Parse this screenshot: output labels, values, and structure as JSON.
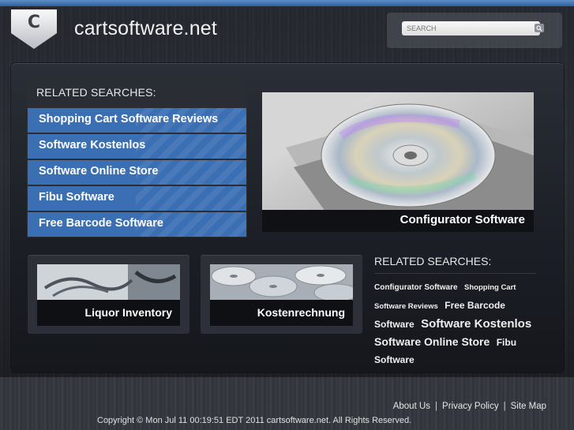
{
  "header": {
    "logo_letter": "C",
    "site_title": "cartsoftware.net"
  },
  "search": {
    "placeholder": "SEARCH",
    "button_icon": "search-icon"
  },
  "related_main": {
    "title": "RELATED SEARCHES:",
    "items": [
      "Shopping Cart Software Reviews",
      "Software Kostenlos",
      "Software Online Store",
      "Fibu Software",
      "Free Barcode Software"
    ]
  },
  "hero": {
    "caption": "Configurator Software"
  },
  "thumbs": [
    {
      "caption": "Liquor Inventory"
    },
    {
      "caption": "Kostenrechnung"
    }
  ],
  "related_side": {
    "title": "RELATED SEARCHES:",
    "tags": [
      "Configurator Software",
      "Shopping Cart Software Reviews",
      "Free Barcode Software",
      "Software Kostenlos",
      "Software Online Store",
      "Fibu Software"
    ]
  },
  "footer": {
    "links": [
      "About Us",
      "Privacy Policy",
      "Site Map"
    ],
    "copyright": "Copyright © Mon Jul 11 00:19:51 EDT 2011 cartsoftware.net. All Rights Reserved."
  },
  "colors": {
    "accent_blue": "#3b6fb3",
    "top_bar": "#2b5f9c",
    "caption_bg": "#101114"
  }
}
